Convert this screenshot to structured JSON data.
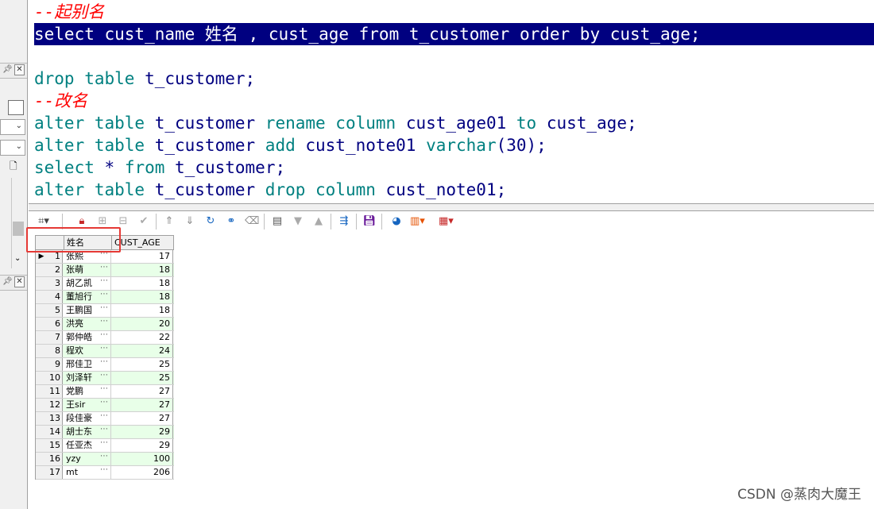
{
  "editor": {
    "lines": [
      {
        "type": "comment",
        "text": "--起别名"
      },
      {
        "type": "selected",
        "text": "select cust_name 姓名 , cust_age from t_customer order by cust_age;"
      },
      {
        "type": "blank",
        "text": ""
      },
      {
        "type": "code",
        "parts": [
          [
            "kw",
            "drop table "
          ],
          [
            "id",
            "t_customer;"
          ]
        ]
      },
      {
        "type": "comment",
        "text": "--改名"
      },
      {
        "type": "code",
        "parts": [
          [
            "kw",
            "alter table "
          ],
          [
            "id",
            "t_customer "
          ],
          [
            "kw",
            "rename column "
          ],
          [
            "id",
            "cust_age01 "
          ],
          [
            "kw",
            "to "
          ],
          [
            "id",
            "cust_age;"
          ]
        ]
      },
      {
        "type": "code",
        "parts": [
          [
            "kw",
            "alter table "
          ],
          [
            "id",
            "t_customer "
          ],
          [
            "kw",
            "add "
          ],
          [
            "id",
            "cust_note01 "
          ],
          [
            "kw",
            "varchar"
          ],
          [
            "id",
            "(30);"
          ]
        ]
      },
      {
        "type": "code",
        "parts": [
          [
            "kw",
            "select "
          ],
          [
            "id",
            "* "
          ],
          [
            "kw",
            "from "
          ],
          [
            "id",
            "t_customer;"
          ]
        ]
      },
      {
        "type": "code",
        "parts": [
          [
            "kw",
            "alter table "
          ],
          [
            "id",
            "t_customer "
          ],
          [
            "kw",
            "drop column "
          ],
          [
            "id",
            "cust_note01;"
          ]
        ]
      }
    ]
  },
  "grid": {
    "columns": [
      "姓名",
      "CUST_AGE"
    ],
    "rows": [
      {
        "num": "1",
        "name": "张熙",
        "age": "17",
        "current": true
      },
      {
        "num": "2",
        "name": "张萌",
        "age": "18"
      },
      {
        "num": "3",
        "name": "胡乙凯",
        "age": "18"
      },
      {
        "num": "4",
        "name": "董旭行",
        "age": "18"
      },
      {
        "num": "5",
        "name": "王鹏国",
        "age": "18"
      },
      {
        "num": "6",
        "name": "洪亮",
        "age": "20"
      },
      {
        "num": "7",
        "name": "郭仲皓",
        "age": "22"
      },
      {
        "num": "8",
        "name": "程欢",
        "age": "24"
      },
      {
        "num": "9",
        "name": "邢佳卫",
        "age": "25"
      },
      {
        "num": "10",
        "name": "刘泽轩",
        "age": "25"
      },
      {
        "num": "11",
        "name": "党鹏",
        "age": "27"
      },
      {
        "num": "12",
        "name": "王sir",
        "age": "27"
      },
      {
        "num": "13",
        "name": "段佳豪",
        "age": "27"
      },
      {
        "num": "14",
        "name": "胡士东",
        "age": "29"
      },
      {
        "num": "15",
        "name": "任亚杰",
        "age": "29"
      },
      {
        "num": "16",
        "name": "yzy",
        "age": "100"
      },
      {
        "num": "17",
        "name": "mt",
        "age": "206"
      }
    ]
  },
  "toolbar": {
    "icons": [
      "grid-options-icon",
      "lock-icon",
      "insert-record-icon",
      "delete-record-icon",
      "post-icon",
      "first-record-icon",
      "last-record-icon",
      "refresh-icon",
      "find-icon",
      "clear-icon",
      "export-icon",
      "filter-down-icon",
      "filter-up-icon",
      "query-by-example-icon",
      "save-icon",
      "sql-icon",
      "chart-icon",
      "table-view-icon"
    ]
  },
  "watermark": "CSDN @蒸肉大魔王",
  "colors": {
    "keyword": "#008080",
    "identifier": "#000080",
    "comment": "#ff0000",
    "selection": "#000080",
    "alt_row": "#e8ffe8",
    "highlight": "#e53935"
  }
}
